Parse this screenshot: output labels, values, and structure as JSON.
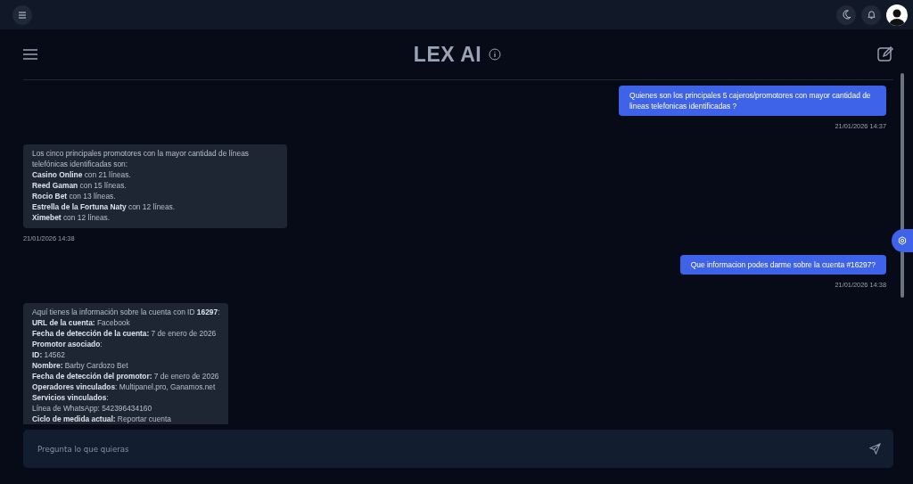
{
  "header": {
    "title": "LEX AI"
  },
  "messages": [
    {
      "kind": "user",
      "lines": [
        "Quienes son los principales 5 cajeros/promotores con mayor cantidad de lineas telefonicas identificadas ?"
      ],
      "time": "21/01/2026 14:37"
    },
    {
      "kind": "assistant",
      "lines": [
        "Los cinco principales promotores con la mayor cantidad de líneas telefónicas identificadas son:",
        "**Casino Online** con 21 líneas.",
        "**Reed Gaman** con 15 líneas.",
        "**Rocio Bet** con 13 líneas.",
        "**Estrella de la Fortuna Naty** con 12 líneas.",
        "**Ximebet** con 12 líneas."
      ],
      "time": "21/01/2026 14:38"
    },
    {
      "kind": "user",
      "lines": [
        "Que informacion podes darme sobre la cuenta #16297?"
      ],
      "time": "21/01/2026 14:38"
    },
    {
      "kind": "assistant",
      "lines": [
        "Aquí tienes la información sobre la cuenta con ID **16297**:",
        "**URL de la cuenta:** Facebook",
        "**Fecha de detección de la cuenta:** 7 de enero de 2026",
        "**Promotor asociado**:",
        "**ID:** 14562",
        "**Nombre:** Barby Cardozo Bet",
        "**Fecha de detección del promotor:** 7 de enero de 2026",
        "**Operadores vinculados**: Multipanel.pro, Ganamos.net",
        "**Servicios vinculados**:",
        "Línea de WhatsApp: 542396434160",
        "**Ciclo de medida actual:** Reportar cuenta"
      ]
    }
  ],
  "composer": {
    "placeholder": "Pregunta lo que quieras"
  }
}
